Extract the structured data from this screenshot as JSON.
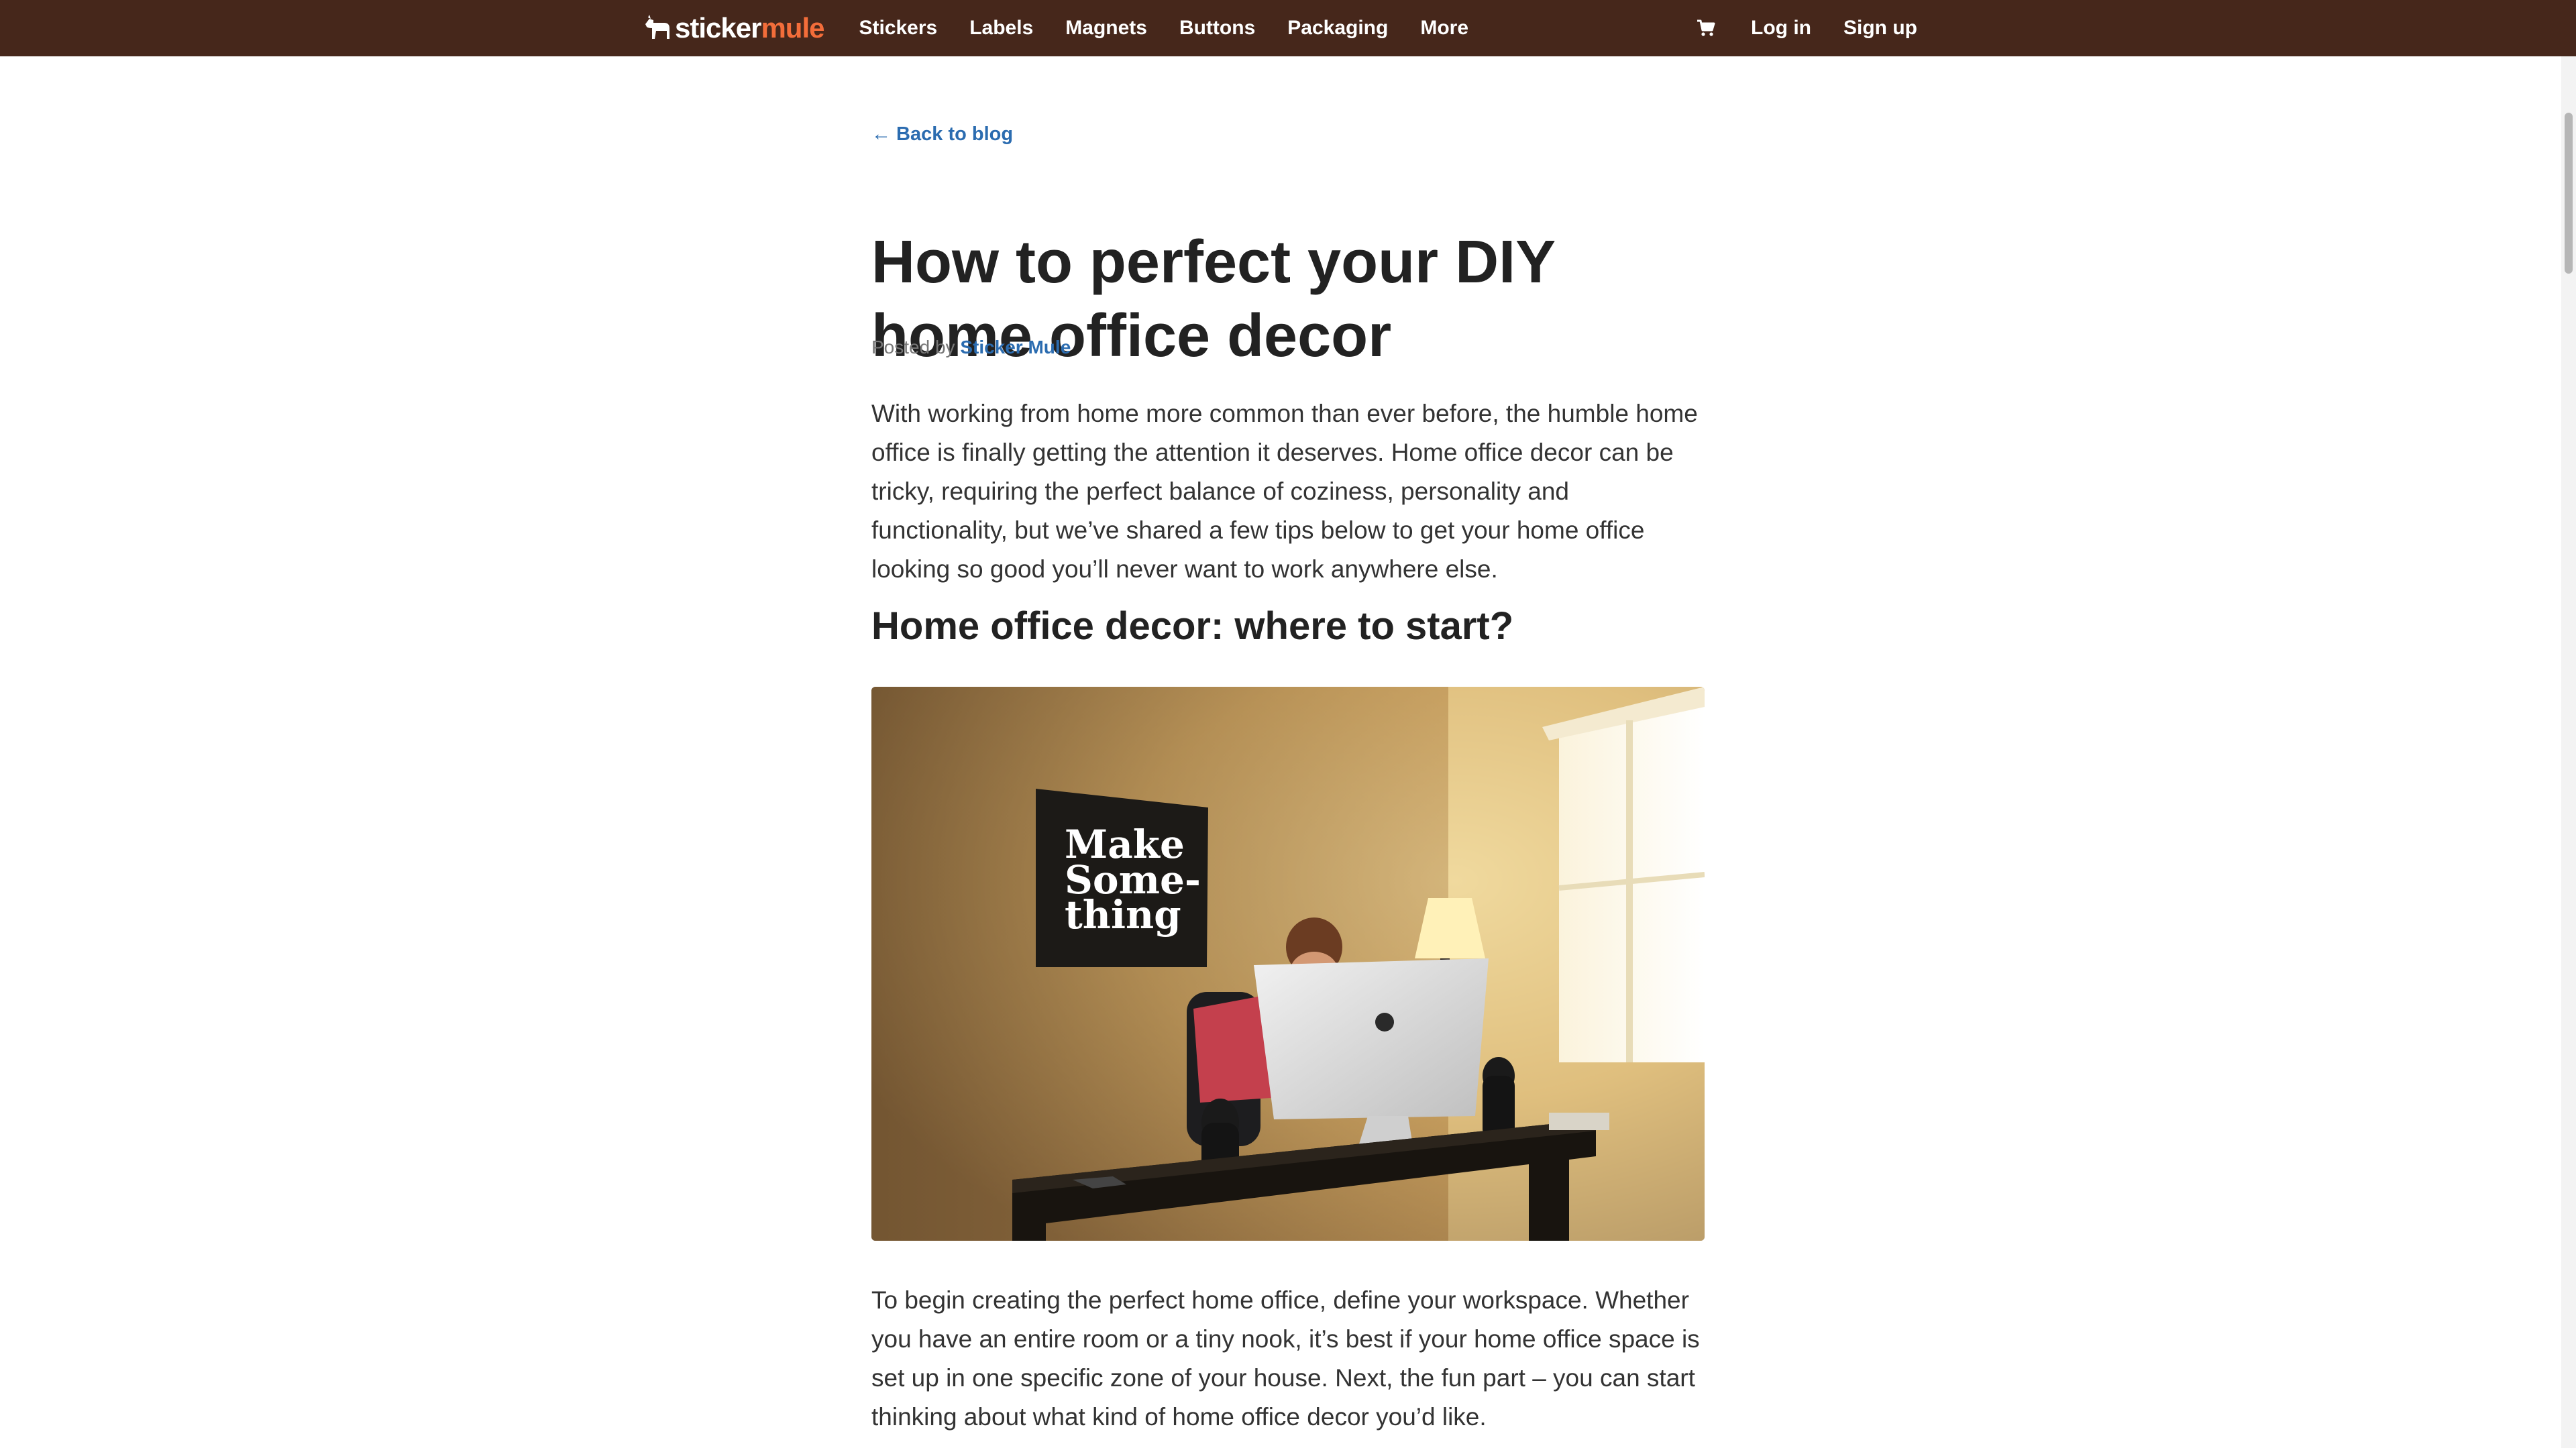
{
  "nav": {
    "logo_part1": "sticker",
    "logo_part2": "mule",
    "items": [
      "Stickers",
      "Labels",
      "Magnets",
      "Buttons",
      "Packaging",
      "More"
    ],
    "login": "Log in",
    "signup": "Sign up",
    "cart_icon": "cart-icon"
  },
  "article": {
    "back_link": "← Back to blog",
    "title": "How to perfect your DIY home office decor",
    "posted_by": "Posted by",
    "author": "Sticker Mule",
    "intro": "With working from home more common than ever before, the humble home office is finally getting the attention it deserves. Home office decor can be tricky, requiring the perfect balance of coziness, personality and functionality, but we’ve shared a few tips below to get your home office looking so good you’ll never want to work anywhere else.",
    "section_heading": "Home office decor: where to start?",
    "poster_text": [
      "Make",
      "Some-",
      "thing"
    ],
    "body": "To begin creating the perfect home office, define your workspace. Whether you have an entire room or a tiny nook, it’s best if your home office space is set up in one specific zone of your house. Next, the fun part – you can start thinking about what kind of home office decor you’d like."
  },
  "colors": {
    "nav_bg": "#46271b",
    "brand_orange": "#f36d3a",
    "link_blue": "#2b6cb0"
  }
}
